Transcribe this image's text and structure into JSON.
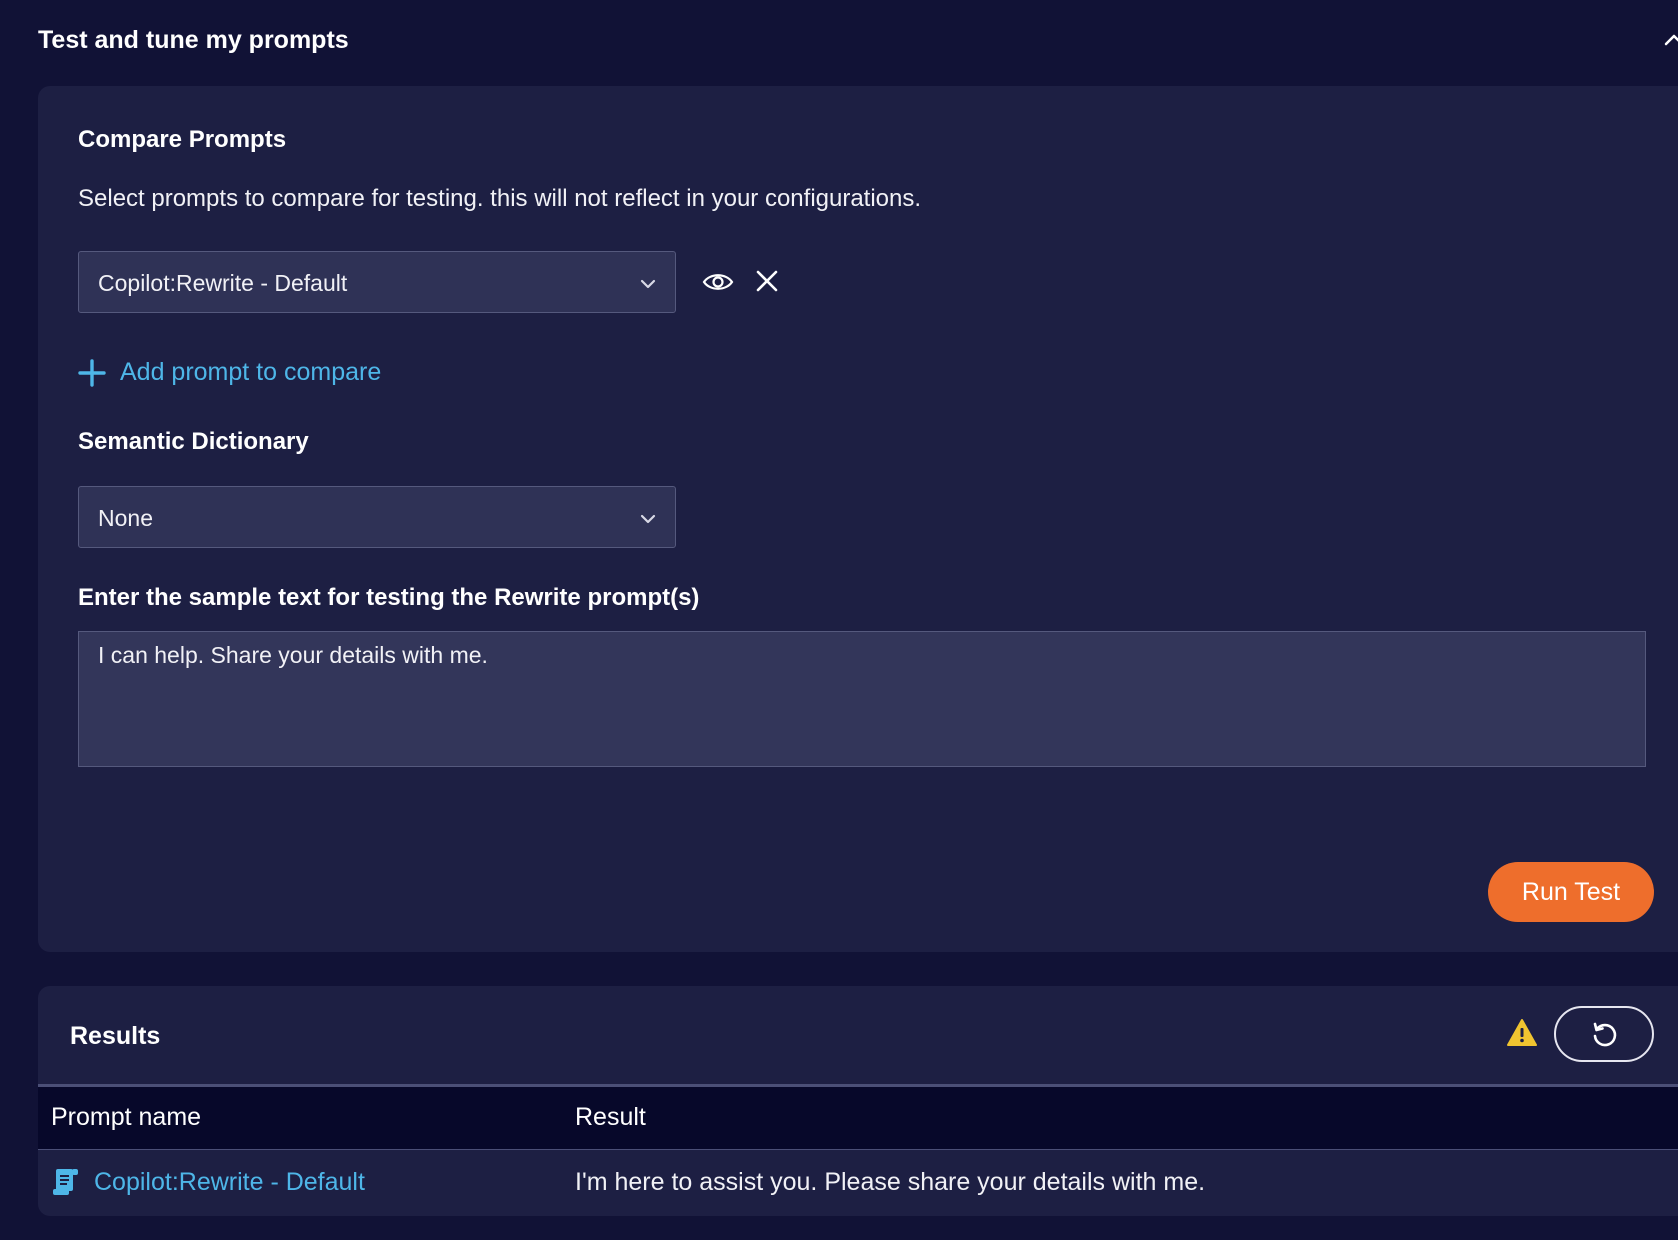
{
  "header": {
    "title": "Test and tune my prompts"
  },
  "compare": {
    "title": "Compare Prompts",
    "description": "Select prompts to compare for testing. this will not reflect in your configurations.",
    "selected_prompt": "Copilot:Rewrite - Default",
    "add_label": "Add prompt to compare"
  },
  "dictionary": {
    "title": "Semantic Dictionary",
    "selected": "None"
  },
  "sample": {
    "label": "Enter the sample text for testing the Rewrite prompt(s)",
    "text": "I can help. Share your details with me."
  },
  "actions": {
    "run_label": "Run Test"
  },
  "results": {
    "title": "Results",
    "columns": [
      "Prompt name",
      "Result"
    ],
    "rows": [
      {
        "prompt": "Copilot:Rewrite - Default",
        "result": "I'm here to assist you. Please share your details with me."
      }
    ]
  },
  "colors": {
    "accent_link": "#4eb6e8",
    "primary_button": "#ee6e2c",
    "warning": "#f0c430",
    "background": "#111236",
    "panel": "#1d1f43"
  },
  "icons": {
    "collapse": "chevron-up-icon",
    "dropdown": "chevron-down-icon",
    "preview": "eye-icon",
    "remove": "close-icon",
    "add": "plus-icon",
    "warning": "warning-icon",
    "refresh": "refresh-icon",
    "prompt": "document-icon"
  }
}
